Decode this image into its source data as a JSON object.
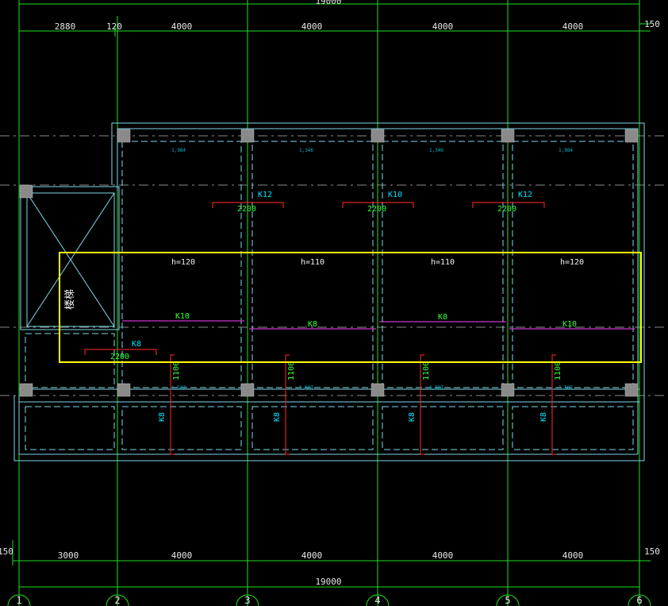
{
  "colors": {
    "background": "#000000",
    "grid": "#00ff00",
    "wall": "#7fd7e6",
    "column": "#808080",
    "rebar_h": "#cc33cc",
    "rebar_v": "#dd2222",
    "label_cyan": "#00e5ff",
    "label_green": "#33ff33",
    "selection": "#ffff00",
    "centerline": "#888888"
  },
  "dimensions": {
    "top_overall": "19000",
    "top_segments": [
      "2880",
      "120",
      "4000",
      "4000",
      "4000",
      "4000"
    ],
    "top_right_small": "150",
    "bottom_overall": "19000",
    "bottom_segments": [
      "3000",
      "4000",
      "4000",
      "4000",
      "4000"
    ],
    "bottom_left_small": "150",
    "bottom_right_small": "150"
  },
  "axis_labels": [
    "1",
    "2",
    "3",
    "4",
    "5",
    "6"
  ],
  "stair_label": "楼梯",
  "slabs": {
    "thickness_labels": [
      "h=120",
      "h=110",
      "h=110",
      "h=120"
    ],
    "top_rebar_labels": [
      "K12",
      "K10",
      "K12"
    ],
    "top_rebar_lengths": [
      "2200",
      "2200",
      "2200"
    ],
    "mid_rebar_labels": [
      "K10",
      "K8",
      "K8",
      "K10"
    ],
    "stair_rebar_label": "K8",
    "stair_rebar_length": "2200",
    "vertical_rebar_labels": [
      "K8",
      "K8",
      "K8",
      "K8"
    ],
    "vertical_rebar_lengths": [
      "1100",
      "1100",
      "1100",
      "1100"
    ]
  },
  "small_annotations": {
    "top_row": [
      "1,984",
      "1,346",
      "1,346",
      "1,984"
    ],
    "bottom_row": [
      "1,587",
      "1,587",
      "1,587",
      "1,587"
    ]
  }
}
